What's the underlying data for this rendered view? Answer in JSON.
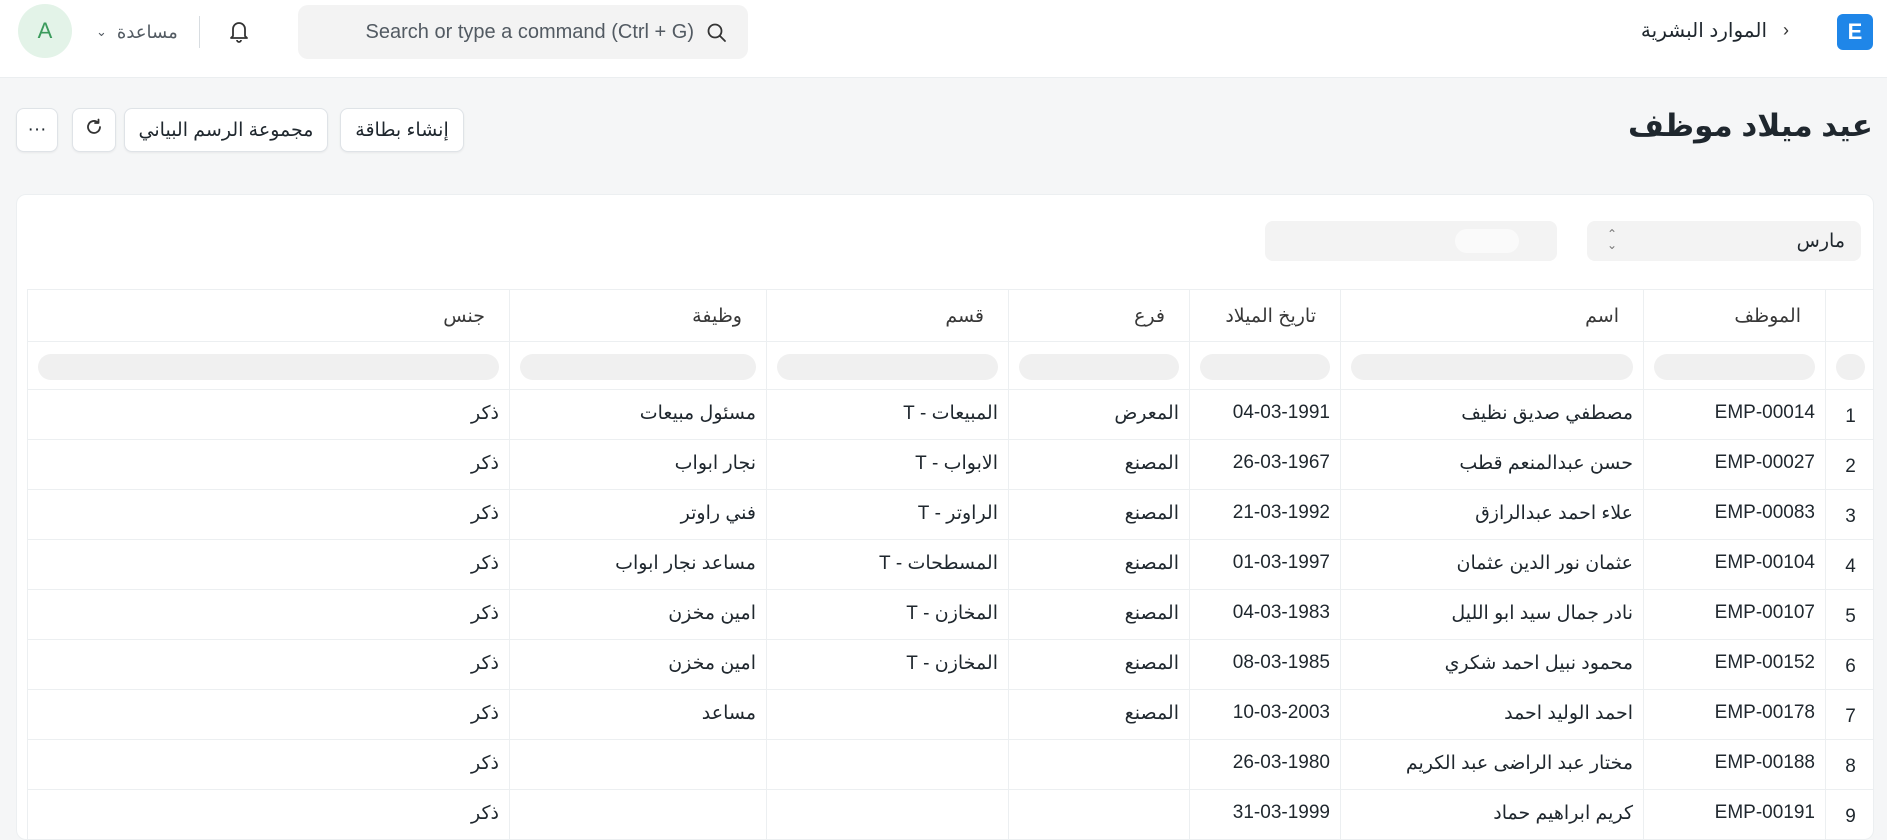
{
  "navbar": {
    "avatar_initial": "A",
    "help_label": "مساعدة",
    "search_placeholder": "Search or type a command (Ctrl + G)",
    "breadcrumb": "الموارد البشرية",
    "app_logo": "E",
    "brand_color": "#1f86e8"
  },
  "page": {
    "title": "عيد ميلاد موظف",
    "buttons": {
      "new_card": "إنشاء بطاقة",
      "chart_group": "مجموعة الرسم البياني",
      "more": "···",
      "refresh_icon": "refresh-icon"
    }
  },
  "filters": {
    "month": "مارس"
  },
  "table": {
    "columns": [
      "الموظف",
      "اسم",
      "تاريخ الميلاد",
      "فرع",
      "قسم",
      "وظيفة",
      "جنس"
    ],
    "rows": [
      {
        "n": "1",
        "id": "EMP-00014",
        "name": "مصطفي صديق نظيف",
        "dob": "04-03-1991",
        "branch": "المعرض",
        "dept": "المبيعات - T",
        "job": "مسئول مبيعات",
        "gender": "ذكر"
      },
      {
        "n": "2",
        "id": "EMP-00027",
        "name": "حسن عبدالمنعم قطب",
        "dob": "26-03-1967",
        "branch": "المصنع",
        "dept": "الابواب - T",
        "job": "نجار ابواب",
        "gender": "ذكر"
      },
      {
        "n": "3",
        "id": "EMP-00083",
        "name": "علاء احمد عبدالرازق",
        "dob": "21-03-1992",
        "branch": "المصنع",
        "dept": "الراوتر - T",
        "job": "فني راوتر",
        "gender": "ذكر"
      },
      {
        "n": "4",
        "id": "EMP-00104",
        "name": "عثمان نور الدين عثمان",
        "dob": "01-03-1997",
        "branch": "المصنع",
        "dept": "المسطحات - T",
        "job": "مساعد نجار ابواب",
        "gender": "ذكر"
      },
      {
        "n": "5",
        "id": "EMP-00107",
        "name": "نادر جمال سيد ابو الليل",
        "dob": "04-03-1983",
        "branch": "المصنع",
        "dept": "المخازن - T",
        "job": "امين مخزن",
        "gender": "ذكر"
      },
      {
        "n": "6",
        "id": "EMP-00152",
        "name": "محمود نبيل احمد شكري",
        "dob": "08-03-1985",
        "branch": "المصنع",
        "dept": "المخازن - T",
        "job": "امين مخزن",
        "gender": "ذكر"
      },
      {
        "n": "7",
        "id": "EMP-00178",
        "name": "احمد الوليد احمد",
        "dob": "10-03-2003",
        "branch": "المصنع",
        "dept": "",
        "job": "مساعد",
        "gender": "ذكر"
      },
      {
        "n": "8",
        "id": "EMP-00188",
        "name": "مختار عبد الراضى عبد الكريم",
        "dob": "26-03-1980",
        "branch": "",
        "dept": "",
        "job": "",
        "gender": "ذكر"
      },
      {
        "n": "9",
        "id": "EMP-00191",
        "name": "كريم ابراهيم حماد",
        "dob": "31-03-1999",
        "branch": "",
        "dept": "",
        "job": "",
        "gender": "ذكر"
      }
    ]
  }
}
